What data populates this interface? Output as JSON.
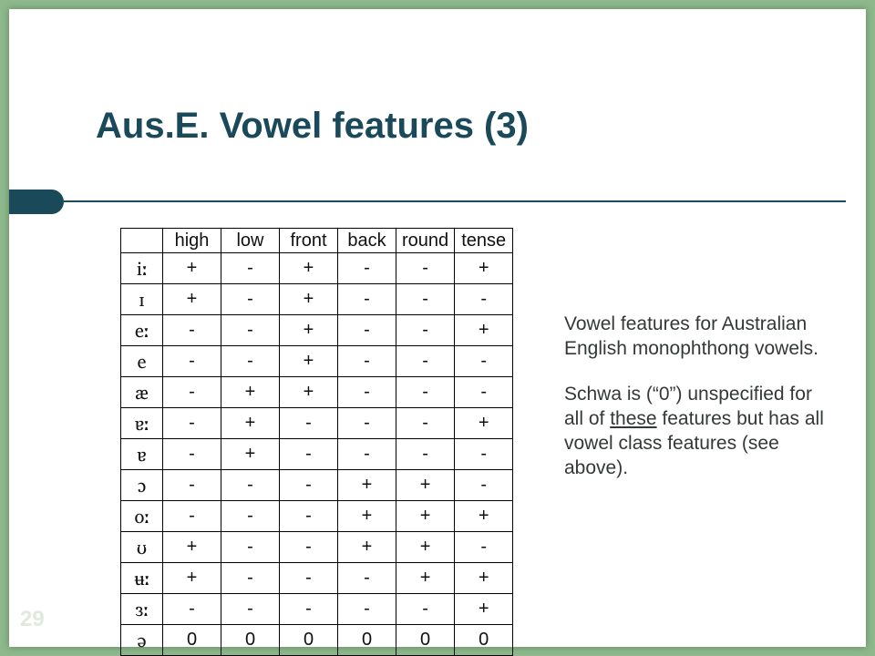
{
  "title": "Aus.E. Vowel features (3)",
  "page_number": "29",
  "columns": [
    "high",
    "low",
    "front",
    "back",
    "round",
    "tense"
  ],
  "rows": [
    {
      "sym": "iː",
      "v": [
        "+",
        "-",
        "+",
        "-",
        "-",
        "+"
      ]
    },
    {
      "sym": "ɪ",
      "v": [
        "+",
        "-",
        "+",
        "-",
        "-",
        "-"
      ]
    },
    {
      "sym": "eː",
      "v": [
        "-",
        "-",
        "+",
        "-",
        "-",
        "+"
      ]
    },
    {
      "sym": "e",
      "v": [
        "-",
        "-",
        "+",
        "-",
        "-",
        "-"
      ]
    },
    {
      "sym": "æ",
      "v": [
        "-",
        "+",
        "+",
        "-",
        "-",
        "-"
      ]
    },
    {
      "sym": "ɐː",
      "v": [
        "-",
        "+",
        "-",
        "-",
        "-",
        "+"
      ]
    },
    {
      "sym": "ɐ",
      "v": [
        "-",
        "+",
        "-",
        "-",
        "-",
        "-"
      ]
    },
    {
      "sym": "ɔ",
      "v": [
        "-",
        "-",
        "-",
        "+",
        "+",
        "-"
      ]
    },
    {
      "sym": "oː",
      "v": [
        "-",
        "-",
        "-",
        "+",
        "+",
        "+"
      ]
    },
    {
      "sym": "ʊ",
      "v": [
        "+",
        "-",
        "-",
        "+",
        "+",
        "-"
      ]
    },
    {
      "sym": "ʉː",
      "v": [
        "+",
        "-",
        "-",
        "-",
        "+",
        "+"
      ]
    },
    {
      "sym": "ɜː",
      "v": [
        "-",
        "-",
        "-",
        "-",
        "-",
        "+"
      ]
    },
    {
      "sym": "ə",
      "v": [
        "0",
        "0",
        "0",
        "0",
        "0",
        "0"
      ]
    }
  ],
  "side": {
    "p1a": "Vowel features for Australian English monophthong vowels.",
    "p2a": "Schwa is (“0”) unspecified for all of ",
    "p2u": "these",
    "p2b": " features but has all vowel class features (see above)."
  }
}
